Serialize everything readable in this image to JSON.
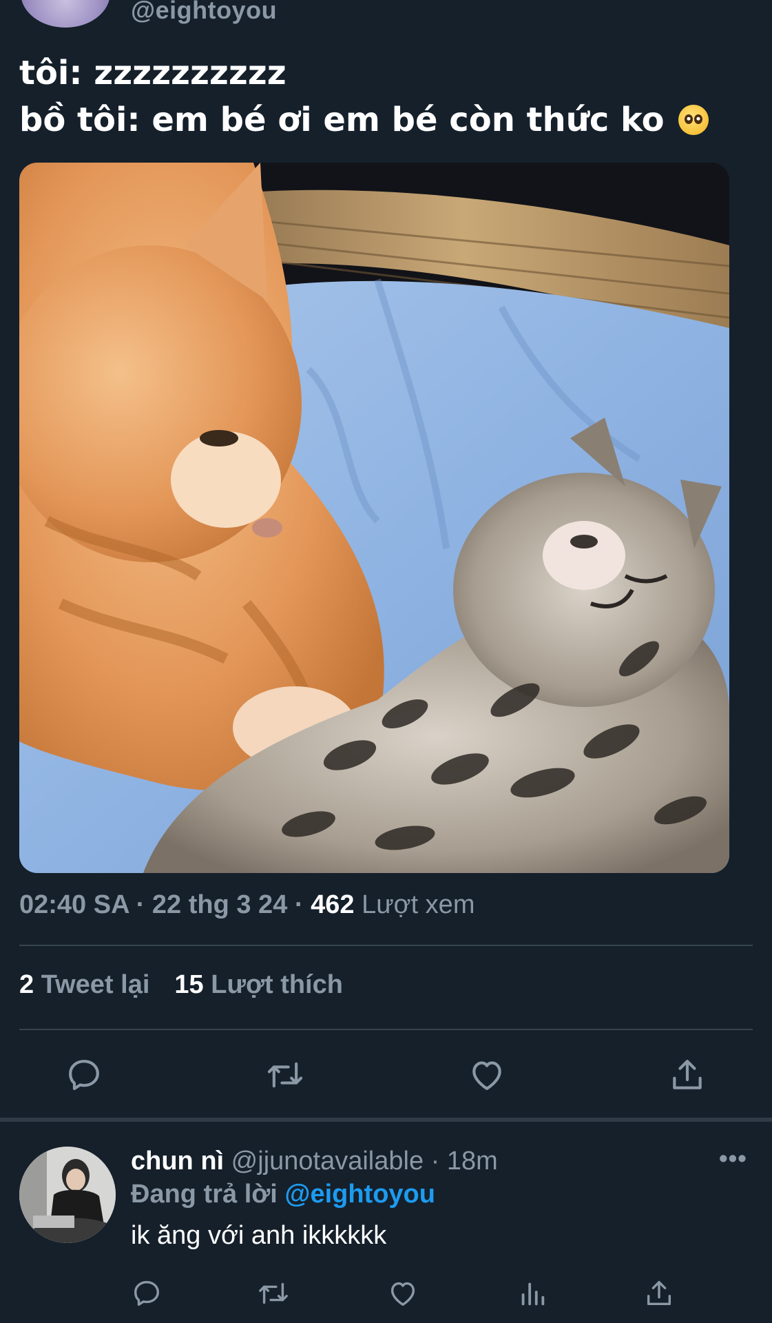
{
  "tweet": {
    "handle": "@eightoyou",
    "text_line1": "tôi: zzzzzzzzzz",
    "text_line2": "bồ tôi: em bé ơi em bé còn thức ko",
    "emoji": "pleading-face",
    "time": "02:40 SA",
    "date": "22 thg 3 24",
    "views_count": "462",
    "views_label": "Lượt xem",
    "retweets_count": "2",
    "retweets_label": "Tweet lại",
    "likes_count": "15",
    "likes_label": "Lượt thích",
    "actions": [
      "reply-icon",
      "retweet-icon",
      "like-icon",
      "share-icon"
    ]
  },
  "reply": {
    "name": "chun nì",
    "handle": "@jjunotavailable",
    "time": "18m",
    "replying_label": "Đang trả lời",
    "replying_to": "@eightoyou",
    "text": "ik ăng với anh ikkkkkk",
    "actions": [
      "reply-icon",
      "retweet-icon",
      "like-icon",
      "analytics-icon",
      "share-icon"
    ]
  },
  "colors": {
    "background": "#15202b",
    "text": "#ffffff",
    "muted": "#8b98a5",
    "accent": "#1d9bf0",
    "divider": "#38444d"
  }
}
